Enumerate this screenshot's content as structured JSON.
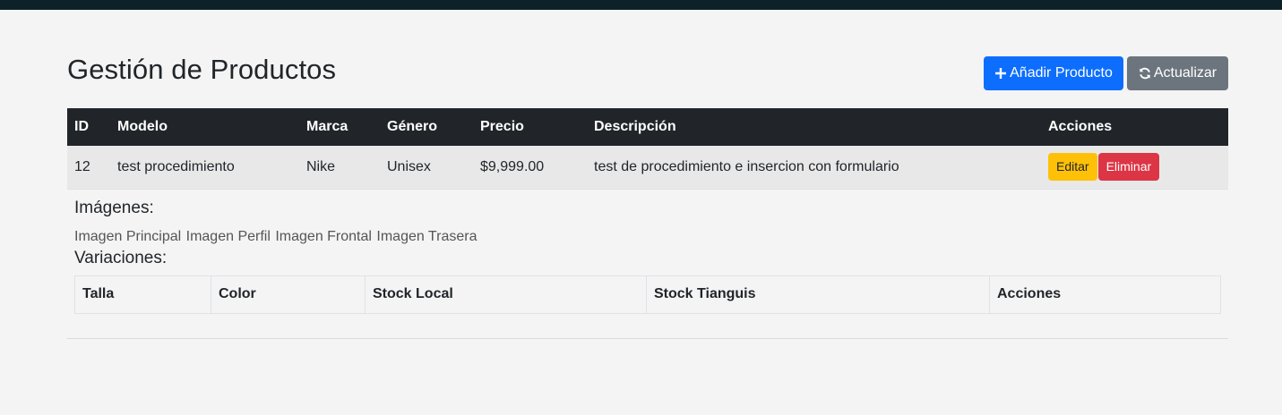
{
  "page": {
    "title": "Gestión de Productos",
    "add_button": "Añadir Producto",
    "refresh_button": "Actualizar"
  },
  "table": {
    "headers": [
      "ID",
      "Modelo",
      "Marca",
      "Género",
      "Precio",
      "Descripción",
      "Acciones"
    ],
    "rows": [
      {
        "id": "12",
        "modelo": "test procedimiento",
        "marca": "Nike",
        "genero": "Unisex",
        "precio": "$9,999.00",
        "descripcion": "test de procedimiento e insercion con formulario",
        "edit_label": "Editar",
        "delete_label": "Eliminar"
      }
    ]
  },
  "details": {
    "images_title": "Imágenes:",
    "images": [
      "Imagen Principal",
      "Imagen Perfil",
      "Imagen Frontal",
      "Imagen Trasera"
    ],
    "variations_title": "Variaciones:",
    "variations_headers": [
      "Talla",
      "Color",
      "Stock Local",
      "Stock Tianguis",
      "Acciones"
    ]
  },
  "colors": {
    "topbar": "#0d2129",
    "primary": "#0d6efd",
    "secondary": "#6c757d",
    "warning": "#ffc107",
    "danger": "#dc3545",
    "table_header": "#212529"
  },
  "icons": {
    "add": "plus-icon",
    "refresh": "refresh-icon"
  }
}
